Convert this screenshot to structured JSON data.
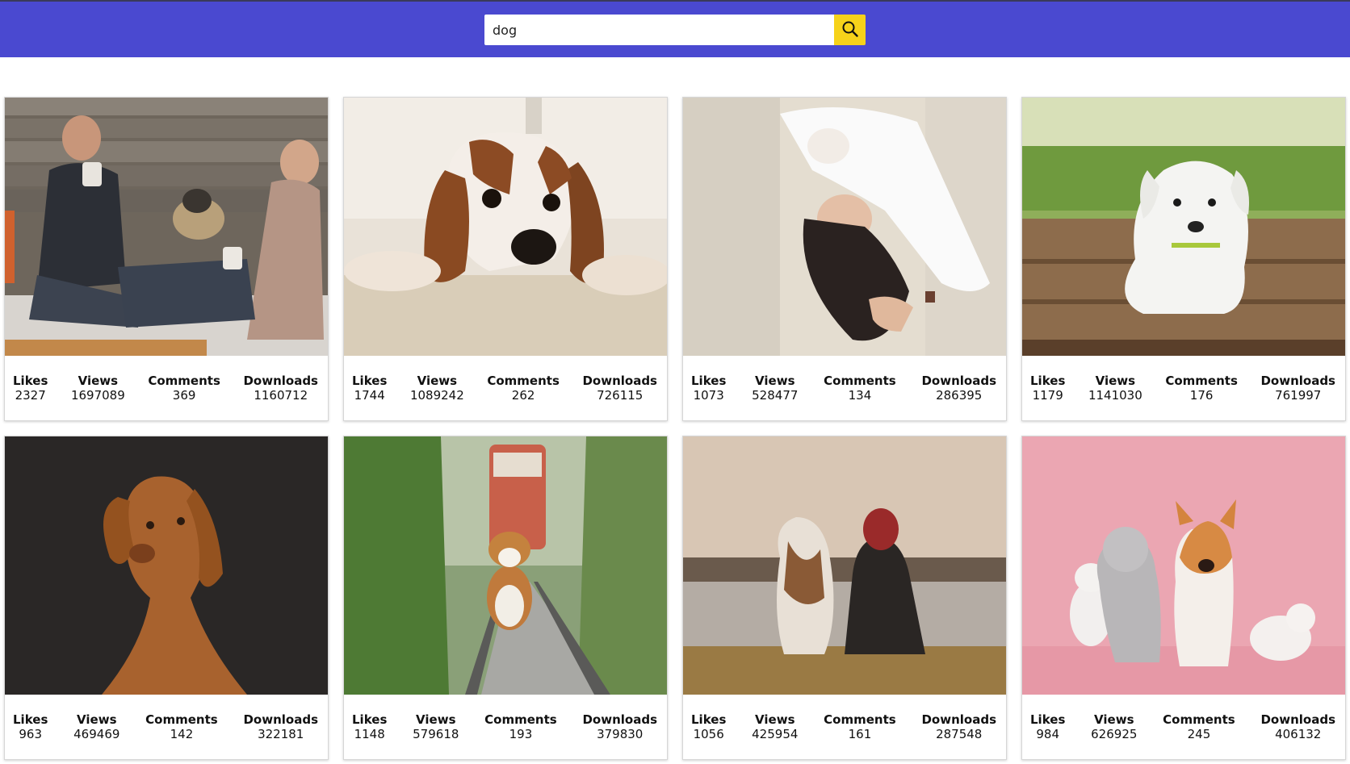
{
  "search": {
    "value": "dog",
    "icon": "search-icon",
    "button_color": "#f6d21a"
  },
  "header": {
    "color": "#4a49d0"
  },
  "labels": {
    "likes": "Likes",
    "views": "Views",
    "comments": "Comments",
    "downloads": "Downloads"
  },
  "cards": [
    {
      "subject": "couple-with-pug",
      "likes": "2327",
      "views": "1697089",
      "comments": "369",
      "downloads": "1160712"
    },
    {
      "subject": "spaniel-puppy-lying",
      "likes": "1744",
      "views": "1089242",
      "comments": "262",
      "downloads": "726115"
    },
    {
      "subject": "woman-on-fur-rug",
      "likes": "1073",
      "views": "528477",
      "comments": "134",
      "downloads": "286395"
    },
    {
      "subject": "white-puppy-on-deck",
      "likes": "1179",
      "views": "1141030",
      "comments": "176",
      "downloads": "761997"
    },
    {
      "subject": "vizsla-portrait",
      "likes": "963",
      "views": "469469",
      "comments": "142",
      "downloads": "322181"
    },
    {
      "subject": "corgi-on-railway",
      "likes": "1148",
      "views": "579618",
      "comments": "193",
      "downloads": "379830"
    },
    {
      "subject": "dog-and-woman-at-lake",
      "likes": "1056",
      "views": "425954",
      "comments": "161",
      "downloads": "287548"
    },
    {
      "subject": "pets-on-pink",
      "likes": "984",
      "views": "626925",
      "comments": "245",
      "downloads": "406132"
    }
  ]
}
